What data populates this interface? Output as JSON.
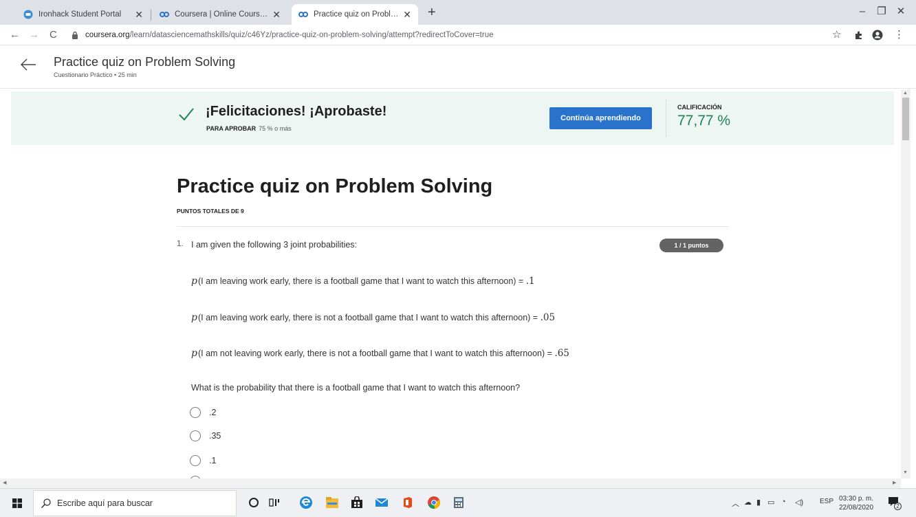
{
  "browser": {
    "tabs": [
      {
        "label": "Ironhack Student Portal",
        "icon": "ironhack-icon",
        "active": false
      },
      {
        "label": "Coursera | Online Courses & Cre",
        "icon": "coursera-icon",
        "active": false
      },
      {
        "label": "Practice quiz on Problem Solving",
        "icon": "coursera-icon",
        "active": true
      }
    ],
    "new_tab": "+",
    "url_host": "coursera.org",
    "url_path": "/learn/datasciencemathskills/quiz/c46Yz/practice-quiz-on-problem-solving/attempt?redirectToCover=true",
    "window_controls": [
      "–",
      "❐",
      "✕"
    ]
  },
  "header": {
    "title": "Practice quiz on Problem Solving",
    "subtitle": "Cuestionario Práctico • 25 min"
  },
  "banner": {
    "congrats": "¡Felicitaciones! ¡Aprobaste!",
    "pass_label": "PARA APROBAR",
    "pass_value": "75 % o más",
    "continue_label": "Continúa aprendiendo",
    "grade_label": "CALIFICACIÓN",
    "grade_value": "77,77 %",
    "colors": {
      "background": "#eef6f4",
      "check": "#1f8354",
      "button": "#2a73cc",
      "grade": "#1f8354"
    }
  },
  "quiz": {
    "title": "Practice quiz on Problem Solving",
    "total_points": "PUNTOS TOTALES DE 9",
    "question_number": "1.",
    "intro": "I am given the following 3 joint probabilities:",
    "points_badge": "1 / 1 puntos",
    "probabilities": [
      {
        "symbol": "p",
        "text": "(I am leaving work early, there is a football game that I want to watch this afternoon) = ",
        "value": ".1"
      },
      {
        "symbol": "p",
        "text": "(I am leaving work early, there is not a football game that I want to watch this afternoon) = ",
        "value": ".05"
      },
      {
        "symbol": "p",
        "text": "(I am not leaving work early, there is not a football game that I want to watch this afternoon) = ",
        "value": ".65"
      }
    ],
    "question": "What is the probability that there is a football game that I want to watch this afternoon?",
    "options": [
      ".2",
      ".35",
      ".1"
    ]
  },
  "taskbar": {
    "search_placeholder": "Escribe aquí para buscar",
    "language": "ESP",
    "time": "03:30 p. m.",
    "date": "22/08/2020",
    "notifications": "2"
  }
}
